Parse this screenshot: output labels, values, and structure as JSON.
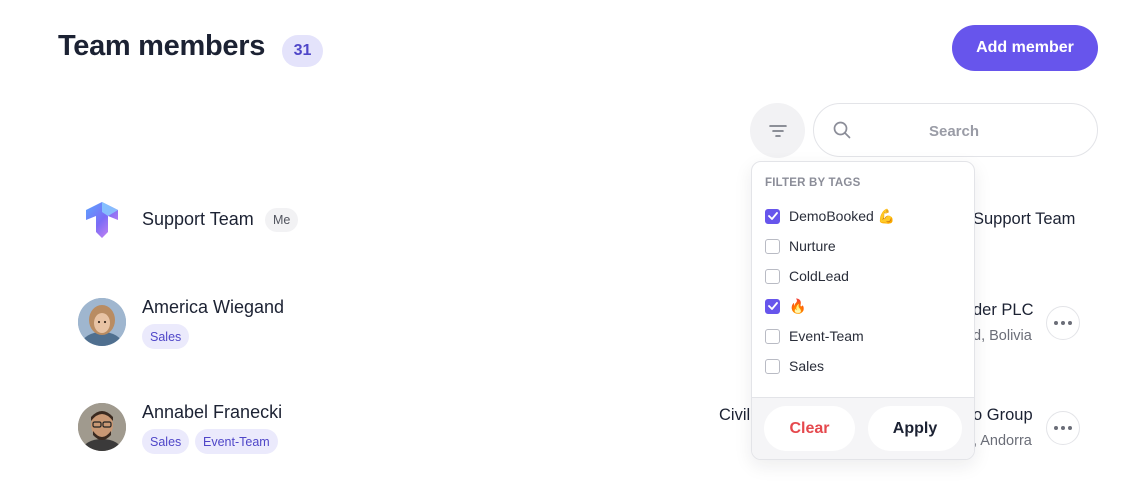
{
  "header": {
    "title": "Team members",
    "count": "31",
    "add_button": "Add member"
  },
  "search": {
    "placeholder": "Search"
  },
  "filter": {
    "title": "FILTER BY TAGS",
    "options": [
      {
        "label": "DemoBooked 💪",
        "checked": true
      },
      {
        "label": "Nurture",
        "checked": false
      },
      {
        "label": "ColdLead",
        "checked": false
      },
      {
        "label": "🔥",
        "checked": true
      },
      {
        "label": "Event-Team",
        "checked": false
      },
      {
        "label": "Sales",
        "checked": false
      }
    ],
    "clear_button": "Clear",
    "apply_button": "Apply"
  },
  "members": [
    {
      "name": "Support Team",
      "badge": "Me",
      "tags": [],
      "right_title": "Support Team",
      "right_sub": ""
    },
    {
      "name": "America Wiegand",
      "badge": "",
      "tags": [
        "Sales"
      ],
      "right_title": "der PLC",
      "right_sub": "d, Bolivia"
    },
    {
      "name": "Annabel Franecki",
      "badge": "",
      "tags": [
        "Sales",
        "Event-Team"
      ],
      "left_title": "Civil",
      "right_title": "o Group",
      "right_sub": ", Andorra"
    }
  ],
  "colors": {
    "accent": "#6755ec",
    "tag_bg": "#ebeafc",
    "tag_text": "#4f46c8",
    "danger": "#e5484d"
  }
}
